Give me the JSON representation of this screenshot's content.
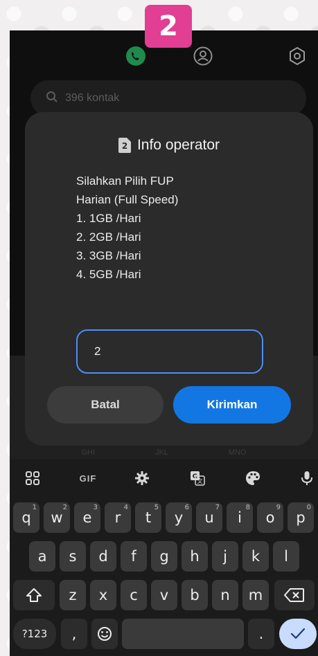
{
  "step_badge": "2",
  "topbar": {
    "icons": [
      "phone-icon",
      "contact-icon",
      "settings-icon"
    ]
  },
  "search": {
    "placeholder": "396 kontak"
  },
  "behind": {
    "labels": [
      "GHI",
      "JKL",
      "MNO"
    ]
  },
  "dialog": {
    "title": "Info operator",
    "sim_badge": "2",
    "message": "Silahkan Pilih FUP\nHarian (Full Speed)\n1.  1GB /Hari\n2.  2GB /Hari\n3.  3GB /Hari\n4.  5GB /Hari",
    "input_value": "2",
    "cancel_label": "Batal",
    "send_label": "Kirimkan"
  },
  "keyboard": {
    "toolbar": {
      "gif_label": "GIF"
    },
    "row1": [
      {
        "k": "q",
        "h": "1"
      },
      {
        "k": "w",
        "h": "2"
      },
      {
        "k": "e",
        "h": "3"
      },
      {
        "k": "r",
        "h": "4"
      },
      {
        "k": "t",
        "h": "5"
      },
      {
        "k": "y",
        "h": "6"
      },
      {
        "k": "u",
        "h": "7"
      },
      {
        "k": "i",
        "h": "8"
      },
      {
        "k": "o",
        "h": "9"
      },
      {
        "k": "p",
        "h": "0"
      }
    ],
    "row2": [
      "a",
      "s",
      "d",
      "f",
      "g",
      "h",
      "j",
      "k",
      "l"
    ],
    "row3": [
      "z",
      "x",
      "c",
      "v",
      "b",
      "n",
      "m"
    ],
    "symbols_label": "?123",
    "comma_label": ",",
    "period_label": "."
  },
  "colors": {
    "badge": "#e23e94",
    "send_button": "#1377e3",
    "input_border": "#4c8ff3",
    "call_icon": "#1f8a4c",
    "enter_key": "#c9dbff"
  }
}
